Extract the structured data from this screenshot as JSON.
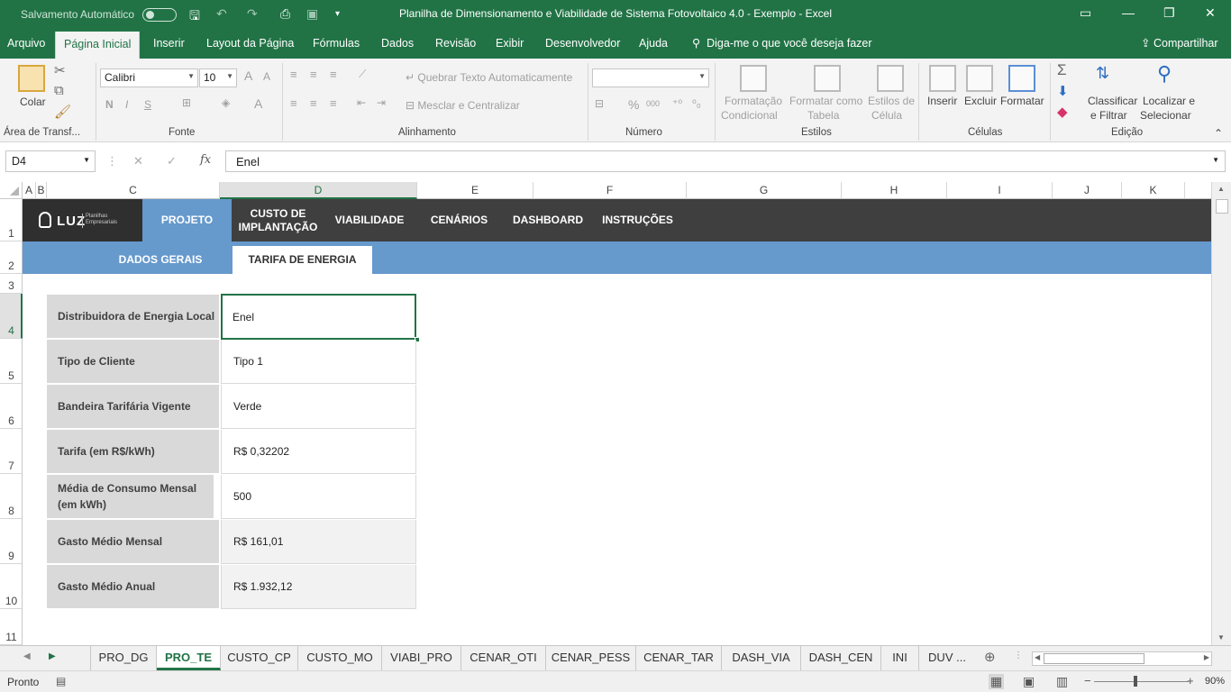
{
  "titlebar": {
    "autosave_label": "Salvamento Automático",
    "title": "Planilha de Dimensionamento e Viabilidade de Sistema Fotovoltaico 4.0 - Exemplo  -  Excel"
  },
  "menu": {
    "items": [
      "Arquivo",
      "Página Inicial",
      "Inserir",
      "Layout da Página",
      "Fórmulas",
      "Dados",
      "Revisão",
      "Exibir",
      "Desenvolvedor",
      "Ajuda"
    ],
    "tell_me": "Diga-me o que você deseja fazer",
    "share": "Compartilhar"
  },
  "ribbon": {
    "clipboard": {
      "paste": "Colar",
      "group": "Área de Transf..."
    },
    "font": {
      "name": "Calibri",
      "size": "10",
      "group": "Fonte"
    },
    "alignment": {
      "wrap": "Quebrar Texto Automaticamente",
      "merge": "Mesclar e Centralizar",
      "group": "Alinhamento"
    },
    "number": {
      "group": "Número",
      "percent": "%",
      "thousands": "000"
    },
    "styles": {
      "conditional_1": "Formatação",
      "conditional_2": "Condicional",
      "table_1": "Formatar como",
      "table_2": "Tabela",
      "cell_1": "Estilos de",
      "cell_2": "Célula",
      "group": "Estilos"
    },
    "cells": {
      "insert": "Inserir",
      "delete": "Excluir",
      "format": "Formatar",
      "group": "Células"
    },
    "editing": {
      "sort_1": "Classificar",
      "sort_2": "e Filtrar",
      "find_1": "Localizar e",
      "find_2": "Selecionar",
      "group": "Edição"
    }
  },
  "formula_bar": {
    "name_box": "D4",
    "fx": "fx",
    "value": "Enel"
  },
  "columns": [
    "A",
    "B",
    "C",
    "D",
    "E",
    "F",
    "G",
    "H",
    "I",
    "J",
    "K"
  ],
  "rows": [
    "1",
    "2",
    "3",
    "4",
    "5",
    "6",
    "7",
    "8",
    "9",
    "10",
    "11"
  ],
  "nav": {
    "logo_text": "LUZ",
    "logo_sub": "Planilhas Empresariais",
    "items": [
      "PROJETO",
      "CUSTO DE IMPLANTAÇÃO",
      "VIABILIDADE",
      "CENÁRIOS",
      "DASHBOARD",
      "INSTRUÇÕES"
    ],
    "sub_items": [
      "DADOS GERAIS",
      "TARIFA DE ENERGIA"
    ]
  },
  "form": [
    {
      "label": "Distribuidora de Energia Local",
      "value": "Enel"
    },
    {
      "label": "Tipo de Cliente",
      "value": "Tipo 1"
    },
    {
      "label": "Bandeira Tarifária Vigente",
      "value": "Verde"
    },
    {
      "label": "Tarifa (em R$/kWh)",
      "value": "R$ 0,32202"
    },
    {
      "label": "Média de Consumo Mensal (em kWh)",
      "value": "500"
    },
    {
      "label": "Gasto Médio Mensal",
      "value": "R$ 161,01"
    },
    {
      "label": "Gasto Médio Anual",
      "value": "R$ 1.932,12"
    }
  ],
  "sheets": [
    "PRO_DG",
    "PRO_TE",
    "CUSTO_CP",
    "CUSTO_MO",
    "VIABI_PRO",
    "CENAR_OTI",
    "CENAR_PESS",
    "CENAR_TAR",
    "DASH_VIA",
    "DASH_CEN",
    "INI",
    "DUV ..."
  ],
  "status": {
    "ready": "Pronto",
    "zoom": "90%"
  }
}
